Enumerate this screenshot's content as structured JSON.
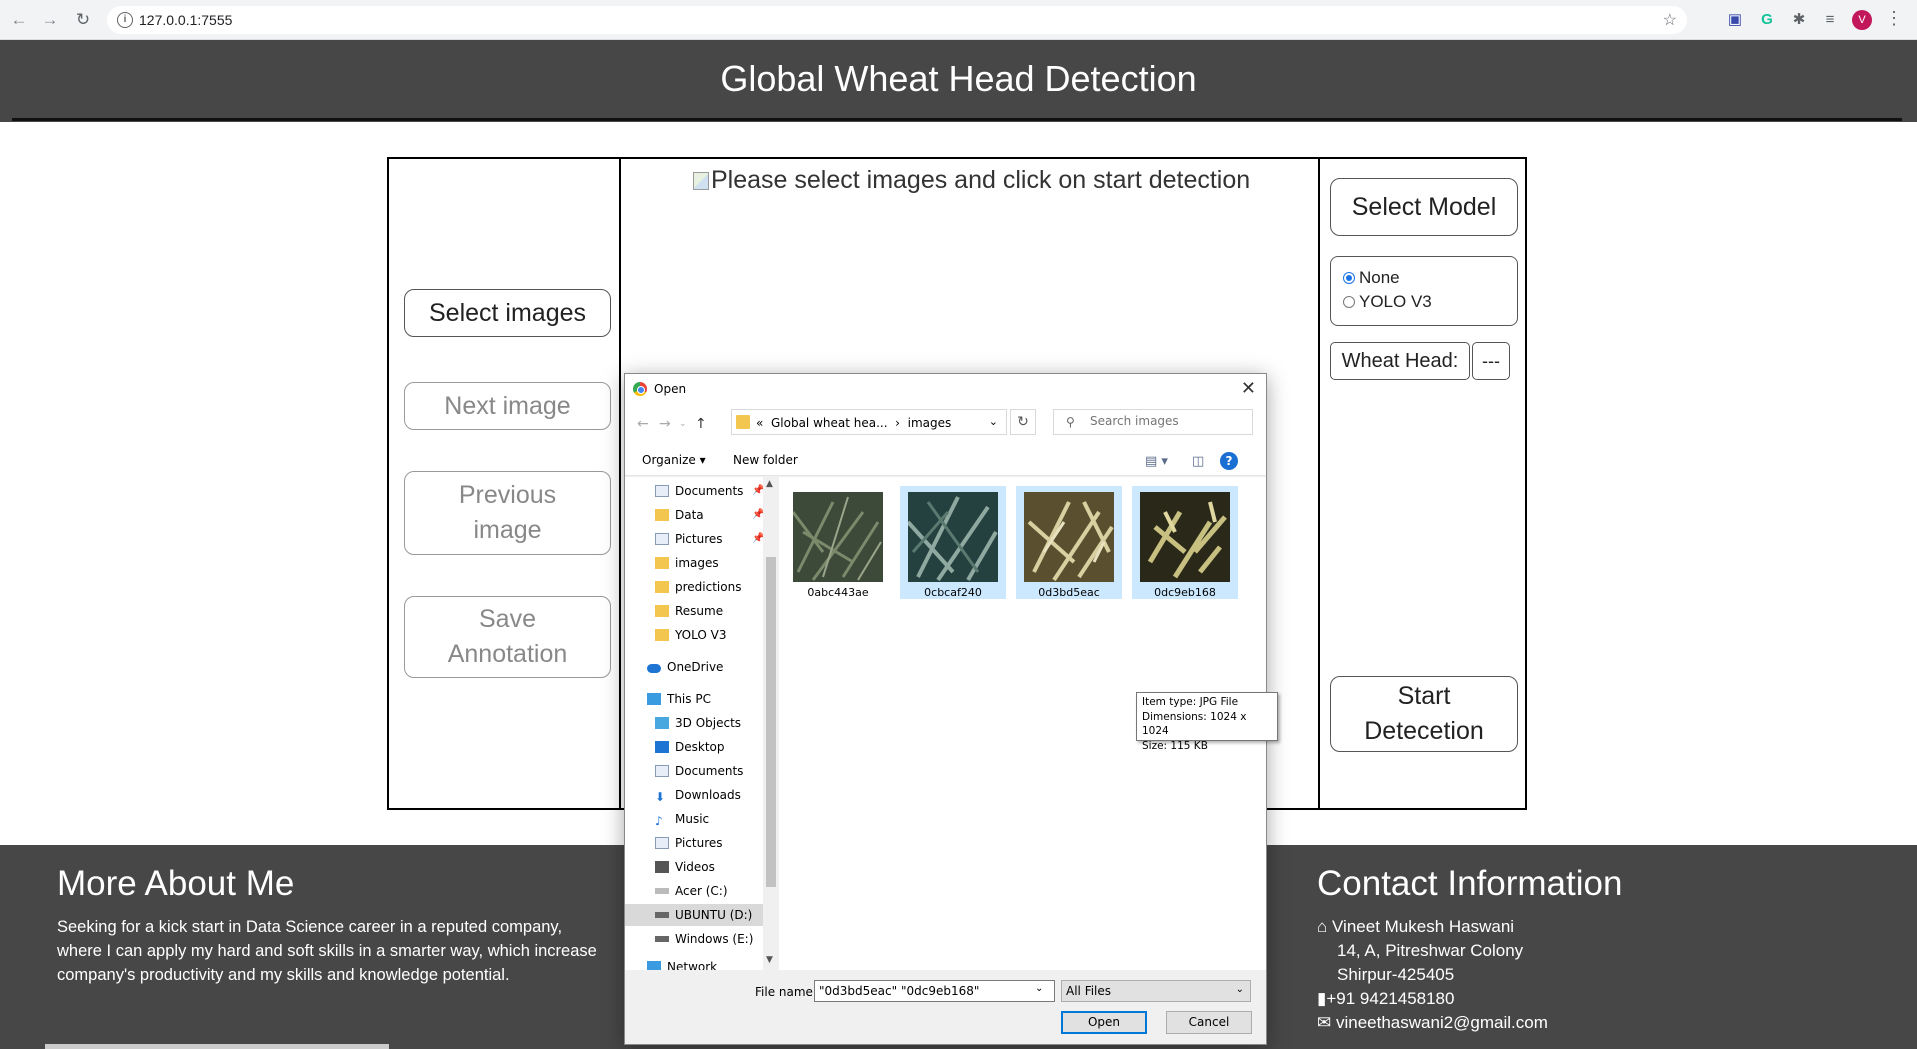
{
  "browser": {
    "url": "127.0.0.1:7555",
    "profile_initial": "V"
  },
  "header": {
    "title": "Global Wheat Head Detection"
  },
  "left_panel": {
    "select_images": "Select images",
    "next_image": "Next image",
    "previous_image": "Previous image",
    "save_annotation": "Save Annotation"
  },
  "center": {
    "placeholder": "Please select images and click on start detection"
  },
  "right_panel": {
    "select_model": "Select Model",
    "models": [
      "None",
      "YOLO V3"
    ],
    "selected_model": "None",
    "wheat_head_label": "Wheat Head:",
    "wheat_head_count": "---",
    "start_detection": "Start Detecetion"
  },
  "footer": {
    "about_title": "More About Me",
    "about_text": "Seeking for a kick start in Data Science career in a reputed company, where I can apply my hard and soft skills in a smarter way, which increase company's productivity and my skills and knowledge potential.",
    "contact_title": "Contact Information",
    "name": "Vineet Mukesh Haswani",
    "address1": "14, A, Pitreshwar Colony",
    "address2": "Shirpur-425405",
    "phone": "+91 9421458180",
    "email": "vineethaswani2@gmail.com"
  },
  "dialog": {
    "title": "Open",
    "breadcrumb_parent": "Global wheat hea...",
    "breadcrumb_current": "images",
    "search_placeholder": "Search images",
    "organize": "Organize",
    "new_folder": "New folder",
    "nav": {
      "quick": [
        "Documents",
        "Data",
        "Pictures",
        "images",
        "predictions",
        "Resume",
        "YOLO V3"
      ],
      "onedrive": "OneDrive",
      "this_pc": "This PC",
      "pc_items": [
        "3D Objects",
        "Desktop",
        "Documents",
        "Downloads",
        "Music",
        "Pictures",
        "Videos",
        "Acer (C:)",
        "UBUNTU (D:)",
        "Windows (E:)"
      ],
      "network": "Network"
    },
    "files": [
      "0abc443ae",
      "0cbcaf240",
      "0d3bd5eac",
      "0dc9eb168"
    ],
    "tooltip": {
      "type": "Item type: JPG File",
      "dimensions": "Dimensions: 1024 x 1024",
      "size": "Size: 115 KB"
    },
    "file_name_label": "File name:",
    "file_name_value": "\"0d3bd5eac\" \"0dc9eb168\"",
    "file_type": "All Files",
    "open_btn": "Open",
    "cancel_btn": "Cancel"
  }
}
